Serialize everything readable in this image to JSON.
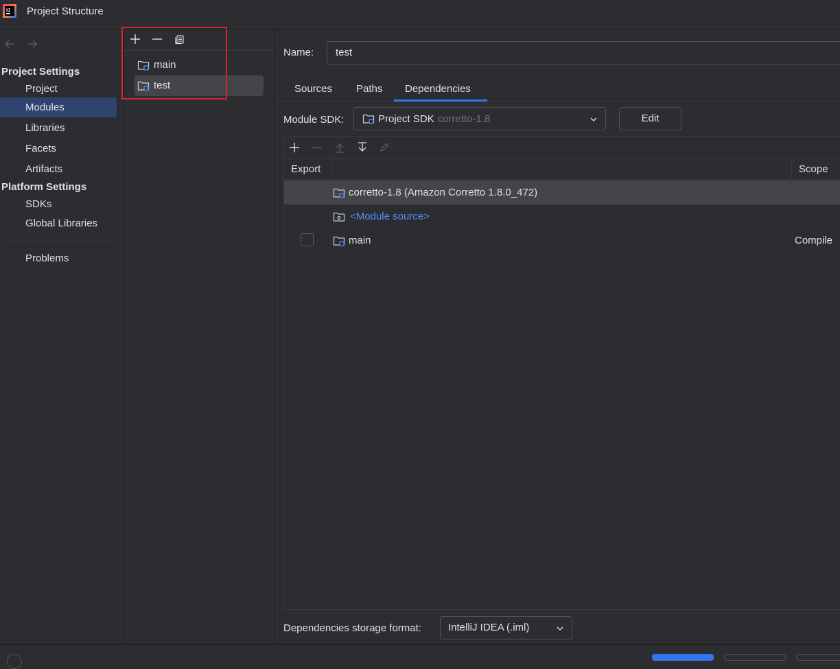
{
  "window": {
    "title": "Project Structure"
  },
  "nav": {
    "back_icon": "arrow-left-icon",
    "forward_icon": "arrow-right-icon",
    "project_settings_heading": "Project Settings",
    "project_settings_items": [
      "Project",
      "Modules",
      "Libraries",
      "Facets",
      "Artifacts"
    ],
    "platform_settings_heading": "Platform Settings",
    "platform_settings_items": [
      "SDKs",
      "Global Libraries"
    ],
    "problems_label": "Problems",
    "selected": "Modules"
  },
  "modules": {
    "toolbar_icons": [
      "plus-icon",
      "minus-icon",
      "copy-icon"
    ],
    "items": [
      "main",
      "test"
    ],
    "selected": "test"
  },
  "module_detail": {
    "name_label": "Name:",
    "name_value": "test",
    "tabs": [
      "Sources",
      "Paths",
      "Dependencies"
    ],
    "active_tab": "Dependencies",
    "sdk_label": "Module SDK:",
    "sdk_value": "Project SDK",
    "sdk_value_hint": "corretto-1.8",
    "edit_label": "Edit",
    "dep_toolbar_icons": [
      "plus-icon",
      "minus-icon",
      "move-up-icon",
      "move-down-icon",
      "edit-pencil-icon"
    ],
    "columns": {
      "export": "Export",
      "scope": "Scope"
    },
    "rows": [
      {
        "label": "corretto-1.8 (Amazon Corretto 1.8.0_472)",
        "scope": "",
        "has_checkbox": false,
        "style": "normal"
      },
      {
        "label": "<Module source>",
        "scope": "",
        "has_checkbox": false,
        "style": "link"
      },
      {
        "label": "main",
        "scope": "Compile",
        "has_checkbox": true,
        "style": "normal"
      }
    ],
    "storage_label": "Dependencies storage format:",
    "storage_value": "IntelliJ IDEA (.iml)"
  },
  "colors": {
    "background": "#2b2d30",
    "selection": "#2e436e",
    "accent": "#3574f0",
    "link": "#548af7",
    "highlight_box": "#e0202b"
  }
}
